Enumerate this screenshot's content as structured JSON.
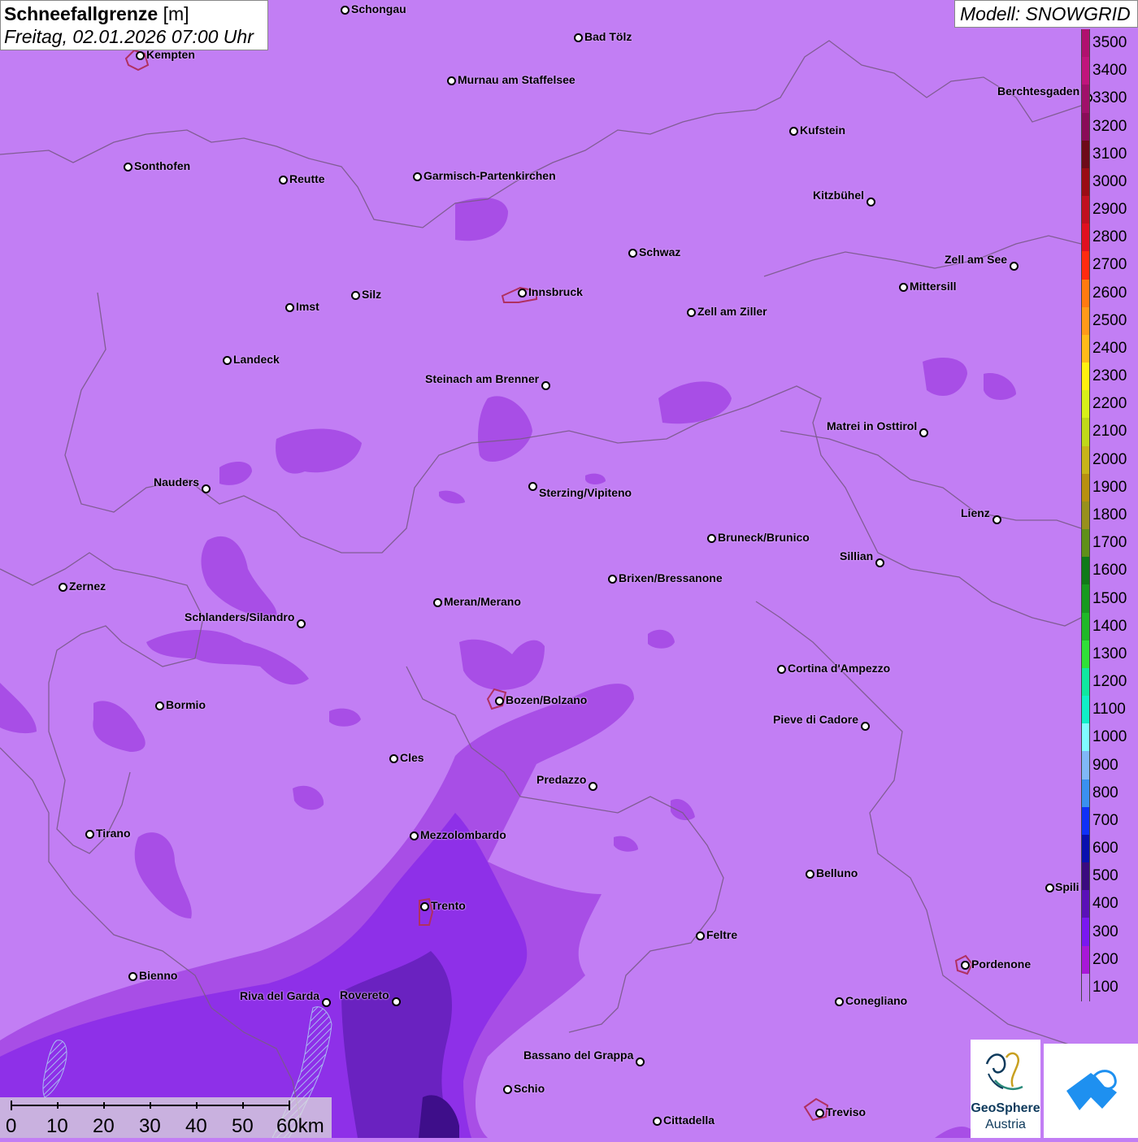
{
  "title": {
    "main": "Schneefallgrenze",
    "unit": "[m]",
    "datetime": "Freitag, 02.01.2026 07:00 Uhr"
  },
  "model": "Modell: SNOWGRID",
  "map": {
    "background_color": "#c27ef4",
    "border_color": "#7a5a8a",
    "lake_color": "#9bb0f0",
    "cities": [
      {
        "name": "Schongau"
      },
      {
        "name": "Bad Tölz"
      },
      {
        "name": "Kempten"
      },
      {
        "name": "Murnau am Staffelsee"
      },
      {
        "name": "Berchtesgaden"
      },
      {
        "name": "Kufstein"
      },
      {
        "name": "Sonthofen"
      },
      {
        "name": "Reutte"
      },
      {
        "name": "Garmisch-Partenkirchen"
      },
      {
        "name": "Kitzbühel"
      },
      {
        "name": "Schwaz"
      },
      {
        "name": "Zell am See"
      },
      {
        "name": "Innsbruck"
      },
      {
        "name": "Mittersill"
      },
      {
        "name": "Imst"
      },
      {
        "name": "Silz"
      },
      {
        "name": "Zell am Ziller"
      },
      {
        "name": "Landeck"
      },
      {
        "name": "Steinach am Brenner"
      },
      {
        "name": "Matrei in Osttirol"
      },
      {
        "name": "Nauders"
      },
      {
        "name": "Sterzing/Vipiteno"
      },
      {
        "name": "Lienz"
      },
      {
        "name": "Bruneck/Brunico"
      },
      {
        "name": "Sillian"
      },
      {
        "name": "Zernez"
      },
      {
        "name": "Brixen/Bressanone"
      },
      {
        "name": "Meran/Merano"
      },
      {
        "name": "Schlanders/Silandro"
      },
      {
        "name": "Cortina d'Ampezzo"
      },
      {
        "name": "Bozen/Bolzano"
      },
      {
        "name": "Bormio"
      },
      {
        "name": "Pieve di Cadore"
      },
      {
        "name": "Cles"
      },
      {
        "name": "Predazzo"
      },
      {
        "name": "Tirano"
      },
      {
        "name": "Mezzolombardo"
      },
      {
        "name": "Belluno"
      },
      {
        "name": "Spili"
      },
      {
        "name": "Trento"
      },
      {
        "name": "Feltre"
      },
      {
        "name": "Pordenone"
      },
      {
        "name": "Bienno"
      },
      {
        "name": "Riva del Garda"
      },
      {
        "name": "Rovereto"
      },
      {
        "name": "Conegliano"
      },
      {
        "name": "Bassano del Grappa"
      },
      {
        "name": "Schio"
      },
      {
        "name": "Treviso"
      },
      {
        "name": "Cittadella"
      }
    ]
  },
  "legend": {
    "unit": "m",
    "levels": [
      {
        "label": "3500",
        "color": "#b0106e"
      },
      {
        "label": "3400",
        "color": "#c0147c"
      },
      {
        "label": "3300",
        "color": "#a0106a"
      },
      {
        "label": "3200",
        "color": "#8a0c58"
      },
      {
        "label": "3100",
        "color": "#6e0a18"
      },
      {
        "label": "3000",
        "color": "#9a0c14"
      },
      {
        "label": "2900",
        "color": "#c01020"
      },
      {
        "label": "2800",
        "color": "#e01020"
      },
      {
        "label": "2700",
        "color": "#ff2a10"
      },
      {
        "label": "2600",
        "color": "#ff7a10"
      },
      {
        "label": "2500",
        "color": "#ff9a18"
      },
      {
        "label": "2400",
        "color": "#ffba18"
      },
      {
        "label": "2300",
        "color": "#fff010"
      },
      {
        "label": "2200",
        "color": "#d8f01a"
      },
      {
        "label": "2100",
        "color": "#c0d818"
      },
      {
        "label": "2000",
        "color": "#c8b418"
      },
      {
        "label": "1900",
        "color": "#b89010"
      },
      {
        "label": "1800",
        "color": "#98901c"
      },
      {
        "label": "1700",
        "color": "#609018"
      },
      {
        "label": "1600",
        "color": "#107a18"
      },
      {
        "label": "1500",
        "color": "#189a20"
      },
      {
        "label": "1400",
        "color": "#20b828"
      },
      {
        "label": "1300",
        "color": "#30e038"
      },
      {
        "label": "1200",
        "color": "#10e8a0"
      },
      {
        "label": "1100",
        "color": "#10f0c8"
      },
      {
        "label": "1000",
        "color": "#80fcff"
      },
      {
        "label": "900",
        "color": "#80b8f8"
      },
      {
        "label": "800",
        "color": "#3a90f0"
      },
      {
        "label": "700",
        "color": "#1030f8"
      },
      {
        "label": "600",
        "color": "#0a10b0"
      },
      {
        "label": "500",
        "color": "#3a0a80"
      },
      {
        "label": "400",
        "color": "#5a10b8"
      },
      {
        "label": "300",
        "color": "#7a18f0"
      },
      {
        "label": "200",
        "color": "#a818d8"
      },
      {
        "label": "100",
        "color": "#c27ef4"
      }
    ]
  },
  "scale_bar": {
    "labels": [
      "0",
      "10",
      "20",
      "30",
      "40",
      "50",
      "60km"
    ]
  },
  "logos": {
    "geosphere": {
      "name": "GeoSphere",
      "country": "Austria"
    }
  }
}
